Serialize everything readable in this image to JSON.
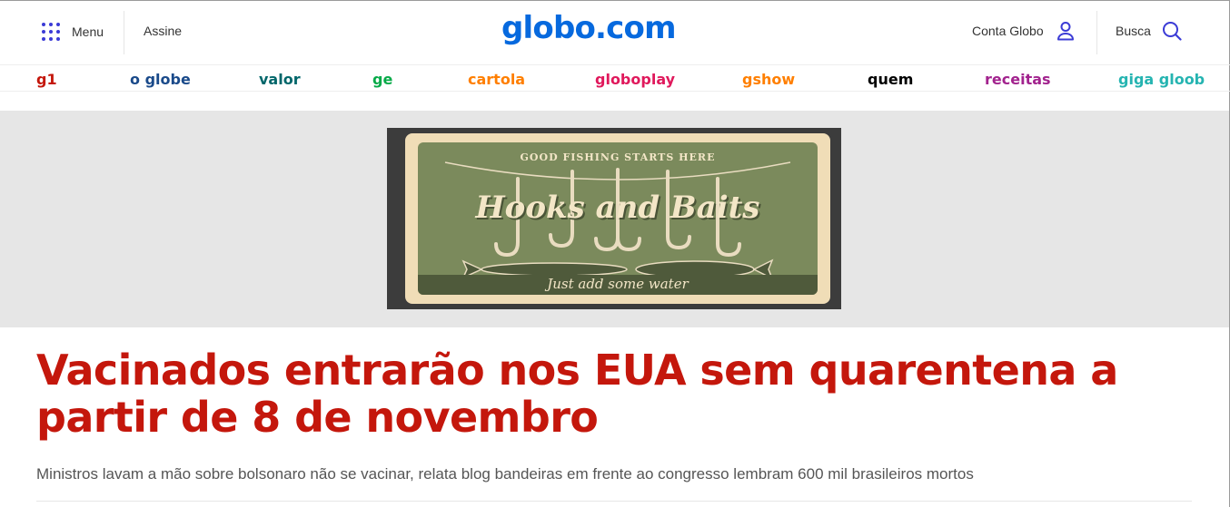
{
  "header": {
    "menu_label": "Menu",
    "assine_label": "Assine",
    "logo_text": "globo.com",
    "conta_label": "Conta Globo",
    "busca_label": "Busca",
    "icons": {
      "menu": "grid-dots-icon",
      "account": "user-icon",
      "search": "search-icon"
    },
    "brand_color": "#0669de"
  },
  "nav": {
    "items": [
      {
        "label": "g1",
        "color": "#c4170c"
      },
      {
        "label": "o globe",
        "color": "#1a4a8a"
      },
      {
        "label": "valor",
        "color": "#00666a"
      },
      {
        "label": "ge",
        "color": "#06aa48"
      },
      {
        "label": "cartola",
        "color": "#ff7f00"
      },
      {
        "label": "globoplay",
        "color": "#e0195c"
      },
      {
        "label": "gshow",
        "color": "#ff7f00"
      },
      {
        "label": "quem",
        "color": "#000000"
      },
      {
        "label": "receitas",
        "color": "#a2238e"
      },
      {
        "label": "giga gloob",
        "color": "#25b4b1"
      }
    ]
  },
  "ad": {
    "top_text": "GOOD FISHING STARTS HERE",
    "title": "Hooks and Baits",
    "bottom_text": "Just add some water"
  },
  "article": {
    "headline": "Vacinados entrarão nos EUA sem quarentena a partir de 8 de novembro",
    "subhead": "Ministros lavam a mão sobre bolsonaro não se vacinar, relata blog bandeiras em frente ao congresso lembram 600 mil brasileiros mortos",
    "headline_color": "#c4170c"
  }
}
